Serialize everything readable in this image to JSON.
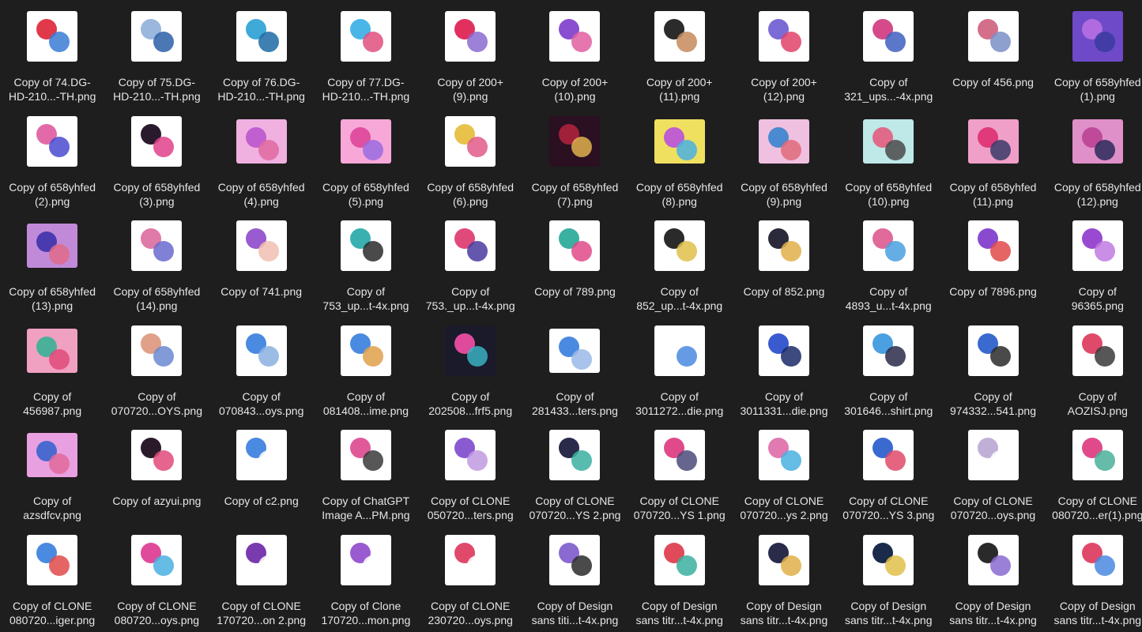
{
  "files": [
    {
      "line1": "Copy of 74.DG-",
      "line2": "HD-210...-TH.png",
      "bg": "#ffffff",
      "a": "#e0394a",
      "b": "#3a7bd5",
      "land": false
    },
    {
      "line1": "Copy of 75.DG-",
      "line2": "HD-210...-TH.png",
      "bg": "#ffffff",
      "a": "#9bb7dd",
      "b": "#2b5fa8",
      "land": false
    },
    {
      "line1": "Copy of 76.DG-",
      "line2": "HD-210...-TH.png",
      "bg": "#ffffff",
      "a": "#3fa9d8",
      "b": "#1d6aa5",
      "land": false
    },
    {
      "line1": "Copy of 77.DG-",
      "line2": "HD-210...-TH.png",
      "bg": "#ffffff",
      "a": "#4ab6e8",
      "b": "#e0507e",
      "land": false
    },
    {
      "line1": "Copy of 200+",
      "line2": "(9).png",
      "bg": "#ffffff",
      "a": "#e2305e",
      "b": "#8a6bd1",
      "land": false
    },
    {
      "line1": "Copy of 200+",
      "line2": "(10).png",
      "bg": "#ffffff",
      "a": "#8a4fd0",
      "b": "#e05fa0",
      "land": false
    },
    {
      "line1": "Copy of 200+",
      "line2": "(11).png",
      "bg": "#ffffff",
      "a": "#2b2b2b",
      "b": "#c58a5b",
      "land": false
    },
    {
      "line1": "Copy of 200+",
      "line2": "(12).png",
      "bg": "#ffffff",
      "a": "#7a6bd6",
      "b": "#e0426a",
      "land": false
    },
    {
      "line1": "Copy of",
      "line2": "321_ups...-4x.png",
      "bg": "#ffffff",
      "a": "#d44a8a",
      "b": "#3e5fbf",
      "land": false
    },
    {
      "line1": "Copy of 456.png",
      "line2": "",
      "bg": "#ffffff",
      "a": "#d46f8a",
      "b": "#7a8fc4",
      "land": false
    },
    {
      "line1": "Copy of 658yhfed",
      "line2": "(1).png",
      "bg": "#6e4ac9",
      "a": "#b06be0",
      "b": "#3a3aa0",
      "land": false
    },
    {
      "line1": "Copy of 658yhfed",
      "line2": "(2).png",
      "bg": "#ffffff",
      "a": "#e36aa8",
      "b": "#4a4ad0",
      "land": false
    },
    {
      "line1": "Copy of 658yhfed",
      "line2": "(3).png",
      "bg": "#ffffff",
      "a": "#2a1a2e",
      "b": "#e0428a",
      "land": false
    },
    {
      "line1": "Copy of 658yhfed",
      "line2": "(4).png",
      "bg": "#f0b0e0",
      "a": "#c05fd0",
      "b": "#e06aa0",
      "land": true
    },
    {
      "line1": "Copy of 658yhfed",
      "line2": "(5).png",
      "bg": "#f7a8d8",
      "a": "#e04fa0",
      "b": "#9a6be0",
      "land": true
    },
    {
      "line1": "Copy of 658yhfed",
      "line2": "(6).png",
      "bg": "#ffffff",
      "a": "#e8c24a",
      "b": "#e05a8a",
      "land": false
    },
    {
      "line1": "Copy of 658yhfed",
      "line2": "(7).png",
      "bg": "#2a1020",
      "a": "#a0203a",
      "b": "#e0b050",
      "land": false
    },
    {
      "line1": "Copy of 658yhfed",
      "line2": "(8).png",
      "bg": "#f0e060",
      "a": "#c05fd0",
      "b": "#4ab0e0",
      "land": true
    },
    {
      "line1": "Copy of 658yhfed",
      "line2": "(9).png",
      "bg": "#f0c0e0",
      "a": "#4a8ad0",
      "b": "#e06a7a",
      "land": true
    },
    {
      "line1": "Copy of 658yhfed",
      "line2": "(10).png",
      "bg": "#bfe8e8",
      "a": "#e06a8a",
      "b": "#4a4a4a",
      "land": true
    },
    {
      "line1": "Copy of 658yhfed",
      "line2": "(11).png",
      "bg": "#f0a0c8",
      "a": "#e03a7a",
      "b": "#3a3a6a",
      "land": true
    },
    {
      "line1": "Copy of 658yhfed",
      "line2": "(12).png",
      "bg": "#e090c8",
      "a": "#c04a9a",
      "b": "#2a2a5a",
      "land": true
    },
    {
      "line1": "Copy of 658yhfed",
      "line2": "(13).png",
      "bg": "#c08ad8",
      "a": "#4a3ab0",
      "b": "#e06a8a",
      "land": true
    },
    {
      "line1": "Copy of 658yhfed",
      "line2": "(14).png",
      "bg": "#ffffff",
      "a": "#e07aa8",
      "b": "#6a6ad0",
      "land": false
    },
    {
      "line1": "Copy of 741.png",
      "line2": "",
      "bg": "#ffffff",
      "a": "#9a5ad0",
      "b": "#f0c0b0",
      "land": false
    },
    {
      "line1": "Copy of",
      "line2": "753_up...t-4x.png",
      "bg": "#ffffff",
      "a": "#3ab0b0",
      "b": "#2a2a2a",
      "land": false
    },
    {
      "line1": "Copy of",
      "line2": "753._up...t-4x.png",
      "bg": "#ffffff",
      "a": "#e04a7a",
      "b": "#4a3aa0",
      "land": false
    },
    {
      "line1": "Copy of 789.png",
      "line2": "",
      "bg": "#ffffff",
      "a": "#3ab0a0",
      "b": "#e04a8a",
      "land": false
    },
    {
      "line1": "Copy of",
      "line2": "852_up...t-4x.png",
      "bg": "#ffffff",
      "a": "#2a2a2a",
      "b": "#e0c04a",
      "land": false
    },
    {
      "line1": "Copy of 852.png",
      "line2": "",
      "bg": "#ffffff",
      "a": "#2a2a3a",
      "b": "#e0b04a",
      "land": false
    },
    {
      "line1": "Copy of",
      "line2": "4893_u...t-4x.png",
      "bg": "#ffffff",
      "a": "#e06a9a",
      "b": "#4aa0e0",
      "land": false
    },
    {
      "line1": "Copy of 7896.png",
      "line2": "",
      "bg": "#ffffff",
      "a": "#8a4ad0",
      "b": "#e04a4a",
      "land": false
    },
    {
      "line1": "Copy of",
      "line2": "96365.png",
      "bg": "#ffffff",
      "a": "#9a4ad0",
      "b": "#c07ae0",
      "land": false
    },
    {
      "line1": "Copy of",
      "line2": "456987.png",
      "bg": "#f0a0c0",
      "a": "#4ab09a",
      "b": "#e04a7a",
      "land": true
    },
    {
      "line1": "Copy of",
      "line2": "070720...OYS.png",
      "bg": "#ffffff",
      "a": "#e0a08a",
      "b": "#6a8ad0",
      "land": false
    },
    {
      "line1": "Copy of",
      "line2": "070843...oys.png",
      "bg": "#ffffff",
      "a": "#4a8ae0",
      "b": "#8ab0e0",
      "land": false
    },
    {
      "line1": "Copy of",
      "line2": "081408...ime.png",
      "bg": "#ffffff",
      "a": "#4a8ae0",
      "b": "#e0a04a",
      "land": false
    },
    {
      "line1": "Copy of",
      "line2": "202508...frf5.png",
      "bg": "#1a1a2a",
      "a": "#e04a9a",
      "b": "#3ab0c0",
      "land": false
    },
    {
      "line1": "Copy of",
      "line2": "281433...ters.png",
      "bg": "#ffffff",
      "a": "#4a8ae0",
      "b": "#9ab8e8",
      "land": true
    },
    {
      "line1": "Copy of",
      "line2": "3011272...die.png",
      "bg": "#ffffff",
      "a": "#ffffff",
      "b": "#4a8ae0",
      "land": false
    },
    {
      "line1": "Copy of",
      "line2": "3011331...die.png",
      "bg": "#ffffff",
      "a": "#3a5ad0",
      "b": "#1a2a6a",
      "land": false
    },
    {
      "line1": "Copy of",
      "line2": "301646...shirt.png",
      "bg": "#ffffff",
      "a": "#4aa0e0",
      "b": "#2a2a4a",
      "land": false
    },
    {
      "line1": "Copy of",
      "line2": "974332...541.png",
      "bg": "#ffffff",
      "a": "#3a6ad0",
      "b": "#2a2a2a",
      "land": false
    },
    {
      "line1": "Copy of",
      "line2": "AOZISJ.png",
      "bg": "#ffffff",
      "a": "#e04a6a",
      "b": "#3a3a3a",
      "land": false
    },
    {
      "line1": "Copy of",
      "line2": "azsdfcv.png",
      "bg": "#e8a0e0",
      "a": "#4a6ad0",
      "b": "#e06a9a",
      "land": true
    },
    {
      "line1": "Copy of azyui.png",
      "line2": "",
      "bg": "#ffffff",
      "a": "#2a1a2a",
      "b": "#e04a7a",
      "land": false
    },
    {
      "line1": "Copy of c2.png",
      "line2": "",
      "bg": "#ffffff",
      "a": "#4a8ae0",
      "b": "#ffffff",
      "land": false
    },
    {
      "line1": "Copy of ChatGPT",
      "line2": "Image A...PM.png",
      "bg": "#ffffff",
      "a": "#e05a9a",
      "b": "#3a3a3a",
      "land": false
    },
    {
      "line1": "Copy of CLONE",
      "line2": "050720...ters.png",
      "bg": "#ffffff",
      "a": "#8a5ad0",
      "b": "#c09ae0",
      "land": false
    },
    {
      "line1": "Copy of CLONE",
      "line2": "070720...YS 2.png",
      "bg": "#ffffff",
      "a": "#2a2a4a",
      "b": "#3ab0a0",
      "land": false
    },
    {
      "line1": "Copy of CLONE",
      "line2": "070720...YS 1.png",
      "bg": "#ffffff",
      "a": "#e04a8a",
      "b": "#4a4a7a",
      "land": false
    },
    {
      "line1": "Copy of CLONE",
      "line2": "070720...ys 2.png",
      "bg": "#ffffff",
      "a": "#e07ab0",
      "b": "#4ab0e0",
      "land": false
    },
    {
      "line1": "Copy of CLONE",
      "line2": "070720...YS 3.png",
      "bg": "#ffffff",
      "a": "#3a6ad0",
      "b": "#e04a6a",
      "land": false
    },
    {
      "line1": "Copy of CLONE",
      "line2": "070720...oys.png",
      "bg": "#ffffff",
      "a": "#c0b0d8",
      "b": "#ffffff",
      "land": false
    },
    {
      "line1": "Copy of CLONE",
      "line2": "080720...er(1).png",
      "bg": "#ffffff",
      "a": "#e04a8a",
      "b": "#4ab09a",
      "land": false
    },
    {
      "line1": "Copy of CLONE",
      "line2": "080720...iger.png",
      "bg": "#ffffff",
      "a": "#4a8ae0",
      "b": "#e04a4a",
      "land": false
    },
    {
      "line1": "Copy of CLONE",
      "line2": "080720...oys.png",
      "bg": "#ffffff",
      "a": "#e04a9a",
      "b": "#4ab0e0",
      "land": false
    },
    {
      "line1": "Copy of CLONE",
      "line2": "170720...on 2.png",
      "bg": "#ffffff",
      "a": "#7a3ab0",
      "b": "#ffffff",
      "land": false
    },
    {
      "line1": "Copy of Clone",
      "line2": "170720...mon.png",
      "bg": "#ffffff",
      "a": "#9a5ad0",
      "b": "#ffffff",
      "land": false
    },
    {
      "line1": "Copy of CLONE",
      "line2": "230720...oys.png",
      "bg": "#ffffff",
      "a": "#e04a6a",
      "b": "#ffffff",
      "land": false
    },
    {
      "line1": "Copy of Design",
      "line2": "sans titi...t-4x.png",
      "bg": "#ffffff",
      "a": "#8a6ad0",
      "b": "#2a2a2a",
      "land": false
    },
    {
      "line1": "Copy of Design",
      "line2": "sans titr...t-4x.png",
      "bg": "#ffffff",
      "a": "#e04a5a",
      "b": "#3ab0a0",
      "land": false
    },
    {
      "line1": "Copy of Design",
      "line2": "sans titr...t-4x.png",
      "bg": "#ffffff",
      "a": "#2a2a4a",
      "b": "#e0b04a",
      "land": false
    },
    {
      "line1": "Copy of Design",
      "line2": "sans titr...t-4x.png",
      "bg": "#ffffff",
      "a": "#1a2a4a",
      "b": "#e0c04a",
      "land": false
    },
    {
      "line1": "Copy of Design",
      "line2": "sans titr...t-4x.png",
      "bg": "#ffffff",
      "a": "#2a2a2a",
      "b": "#8a6ad0",
      "land": false
    },
    {
      "line1": "Copy of Design",
      "line2": "sans titr...t-4x.png",
      "bg": "#ffffff",
      "a": "#e04a6a",
      "b": "#4a8ae0",
      "land": false
    }
  ]
}
